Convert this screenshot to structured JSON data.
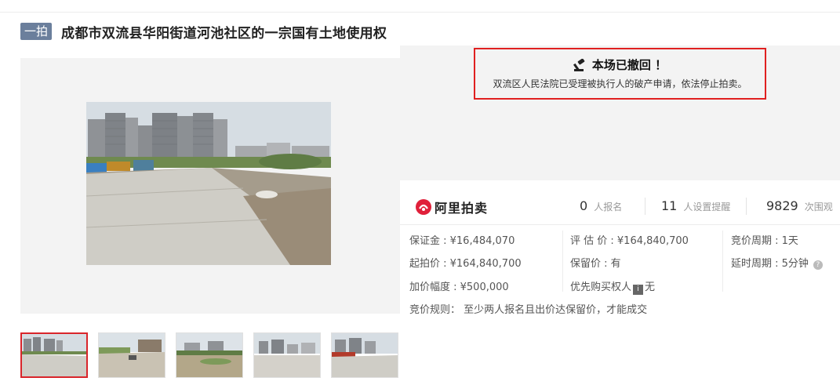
{
  "header": {
    "tag": "一拍",
    "title": "成都市双流县华阳街道河池社区的一宗国有土地使用权"
  },
  "notice": {
    "title": "本场已撤回 ！",
    "text": "双流区人民法院已受理被执行人的破产申请，依法停止拍卖。"
  },
  "brand": {
    "name": "阿里拍卖",
    "accent": "#e0203a"
  },
  "stats": [
    {
      "num": "0",
      "unit": "人报名"
    },
    {
      "num": "11",
      "unit": "人设置提醒"
    },
    {
      "num": "9829",
      "unit": "次围观"
    }
  ],
  "info": {
    "deposit": "保证金 : ¥16,484,070",
    "appraisal": "评 估 价 : ¥164,840,700",
    "bid_period": "竞价周期 : 1天",
    "start_price": "起拍价 : ¥164,840,700",
    "reserve": "保留价 : 有",
    "delay": "延时周期 : 5分钟",
    "increment": "加价幅度 : ¥500,000",
    "priority_label": "优先购买权人",
    "priority_value": "无",
    "rule_label": "竞价规则：",
    "rule_text": "至少两人报名且出价达保留价，才能成交"
  },
  "icons": {
    "gavel": "gavel-icon",
    "help": "help-icon",
    "logo": "auction-logo-icon"
  },
  "colors": {
    "tag_bg": "#6b7f9c",
    "notice_border": "#e02020",
    "thumb_active": "#d9252b"
  }
}
